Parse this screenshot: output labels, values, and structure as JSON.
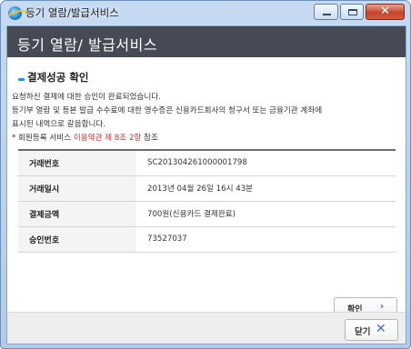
{
  "window": {
    "title": "등기 열람/발급서비스",
    "buttons": {
      "minimize": "minimize",
      "maximize": "maximize",
      "close": "✕"
    }
  },
  "header": {
    "title": "등기 열람/ 발급서비스"
  },
  "section": {
    "title": "결제성공 확인",
    "messages": [
      "요청하신 결제에 대한 승인이 완료되었습니다.",
      "등기부 열람 및 등본 발급 수수료에 대한 영수증은 신용카드회사의 청구서 또는 금융기관 계좌에",
      "표시된 내역으로 갈음합니다."
    ],
    "note_prefix": "* 회원등록 서비스 ",
    "note_highlight": "이용약관 제 8조 2항",
    "note_suffix": " 참조"
  },
  "table": {
    "rows": [
      {
        "label": "거래번호",
        "value": "SC201304261000001798"
      },
      {
        "label": "거래일시",
        "value": "2013년 04월 26일 16시 43분"
      },
      {
        "label": "결제금액",
        "value": "700원(신용카드 결제완료)"
      },
      {
        "label": "승인번호",
        "value": "73527037"
      }
    ]
  },
  "actions": {
    "confirm": "확인",
    "confirm_arrow": "›",
    "close": "닫기",
    "close_icon": "✕"
  },
  "colors": {
    "header_bg": "#454a55",
    "accent": "#2b8ee0",
    "highlight": "#d62b2b"
  }
}
